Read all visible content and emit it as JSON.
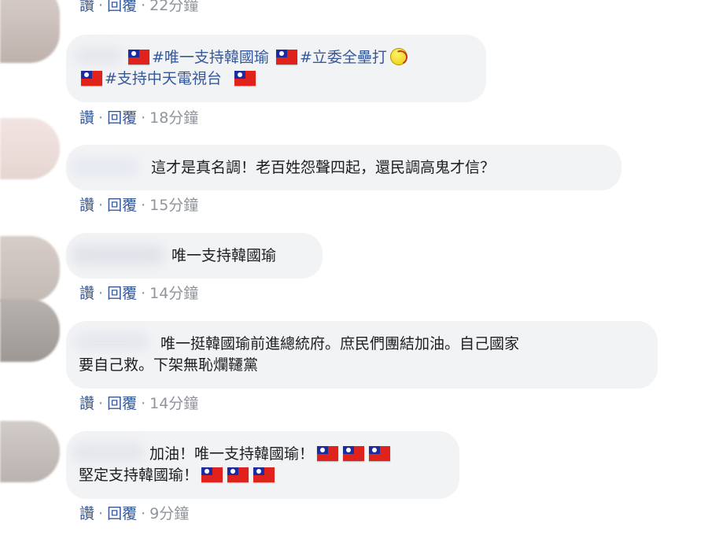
{
  "top_actions": {
    "like": "讚",
    "reply": "回覆",
    "time": "22分鐘"
  },
  "comments": [
    {
      "line1_tag1": "#唯一支持韓國瑜",
      "line1_tag2": "#立委全壘打",
      "line2_tag": "#支持中天電視台",
      "actions": {
        "like": "讚",
        "reply": "回覆",
        "time": "18分鐘"
      }
    },
    {
      "text": "這才是真名調！老百姓怨聲四起，還民調高鬼才信？",
      "actions": {
        "like": "讚",
        "reply": "回覆",
        "time": "15分鐘"
      }
    },
    {
      "text": "唯一支持韓國瑜",
      "actions": {
        "like": "讚",
        "reply": "回覆",
        "time": "14分鐘"
      }
    },
    {
      "line1": "唯一挺韓國瑜前進總統府。庶民們團結加油。自己國家",
      "line2": "要自己救。下架無恥爛韆黨",
      "actions": {
        "like": "讚",
        "reply": "回覆",
        "time": "14分鐘"
      }
    },
    {
      "line1": "加油！唯一支持韓國瑜！",
      "line2": "堅定支持韓國瑜！",
      "actions": {
        "like": "讚",
        "reply": "回覆",
        "time": "9分鐘"
      }
    }
  ],
  "separator": "·",
  "icons": {
    "flag": "taiwan-flag-icon",
    "ball": "softball-icon"
  },
  "colors": {
    "link": "#365899",
    "bubble": "#f2f3f5",
    "muted": "#90949c",
    "text": "#1c1e21"
  }
}
